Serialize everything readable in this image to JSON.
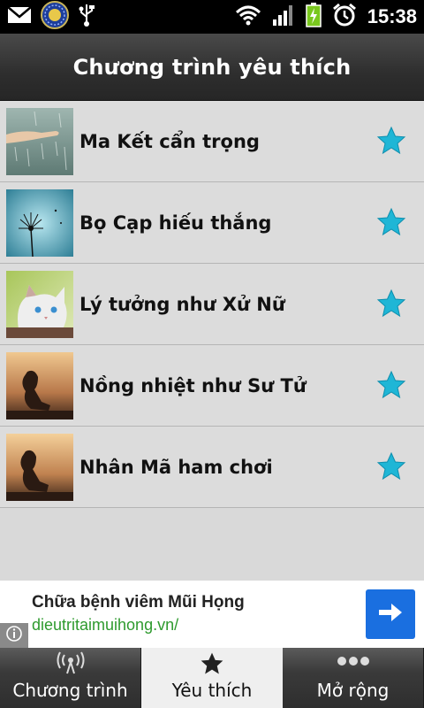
{
  "status_bar": {
    "time": "15:38",
    "icons": [
      "gmail-icon",
      "horoscope-app-icon",
      "usb-icon",
      "wifi-icon",
      "signal-icon",
      "battery-charging-icon",
      "alarm-icon"
    ]
  },
  "header": {
    "title": "Chương trình yêu thích"
  },
  "favorites": [
    {
      "label": "Ma Kết cẩn trọng",
      "thumbnail": "rain-hand-photo",
      "favorited": true
    },
    {
      "label": "Bọ Cạp hiếu thắng",
      "thumbnail": "dandelion-photo",
      "favorited": true
    },
    {
      "label": "Lý tưởng như Xử Nữ",
      "thumbnail": "cat-photo",
      "favorited": true
    },
    {
      "label": "Nồng nhiệt như Sư Tử",
      "thumbnail": "sunset-girl-photo",
      "favorited": true
    },
    {
      "label": "Nhân Mã ham chơi",
      "thumbnail": "sunset-girl-photo-2",
      "favorited": true
    }
  ],
  "ad": {
    "title": "Chữa bệnh viêm Mũi Họng",
    "url": "dieutritaimuihong.vn/",
    "cta_icon": "arrow-right-icon",
    "info_icon": "info-icon"
  },
  "tabs": [
    {
      "label": "Chương trình",
      "icon": "broadcast-icon",
      "active": false
    },
    {
      "label": "Yêu thích",
      "icon": "star-icon",
      "active": true
    },
    {
      "label": "Mở rộng",
      "icon": "more-dots-icon",
      "active": false
    }
  ],
  "colors": {
    "star": "#1fb6d6",
    "ad_button": "#1a6fe0",
    "ad_url": "#2e9a2e",
    "active_tab": "#efefef"
  }
}
